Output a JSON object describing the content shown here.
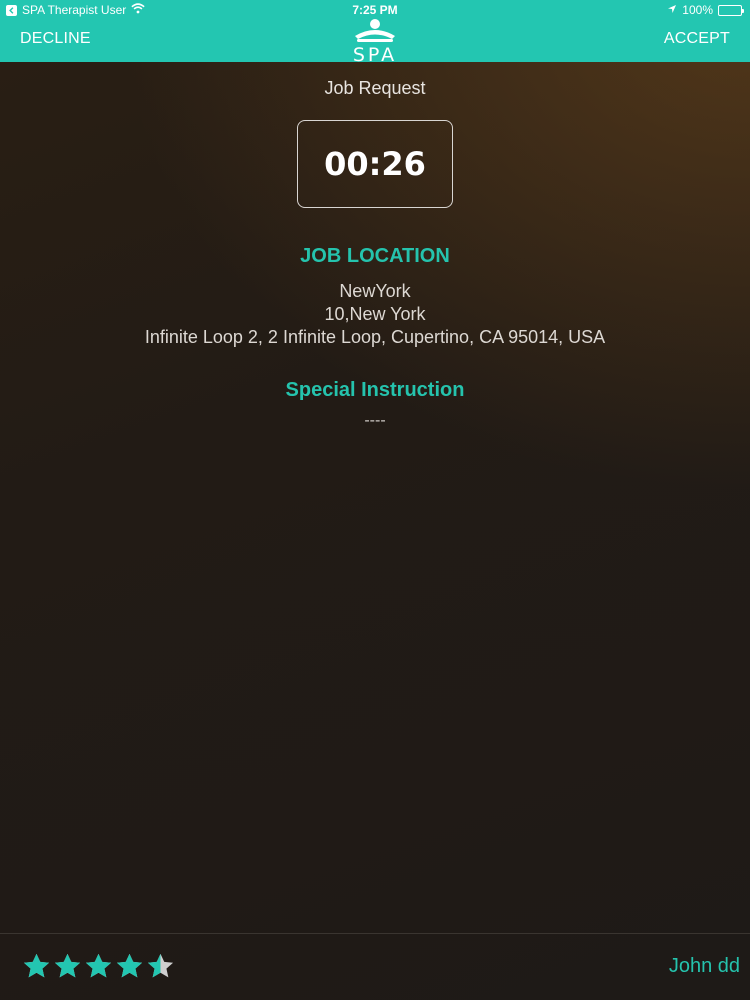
{
  "status_bar": {
    "app_name": "SPA Therapist User",
    "time": "7:25 PM",
    "battery": "100%"
  },
  "nav": {
    "decline_label": "DECLINE",
    "accept_label": "ACCEPT",
    "logo_text": "SPA"
  },
  "job": {
    "heading": "Job Request",
    "timer": "00:26",
    "location_title": "JOB LOCATION",
    "location_line1": "NewYork",
    "location_line2": "10,New York",
    "location_line3": "Infinite Loop 2,  2 Infinite Loop,  Cupertino,  CA 95014,  USA",
    "instruction_title": "Special Instruction",
    "instruction_value": "----"
  },
  "footer": {
    "rating": 4.5,
    "rating_max": 5,
    "user_name": "John dd"
  },
  "colors": {
    "accent": "#23c6b1",
    "star_filled": "#23c6b1",
    "star_empty": "#cfcfcf"
  }
}
